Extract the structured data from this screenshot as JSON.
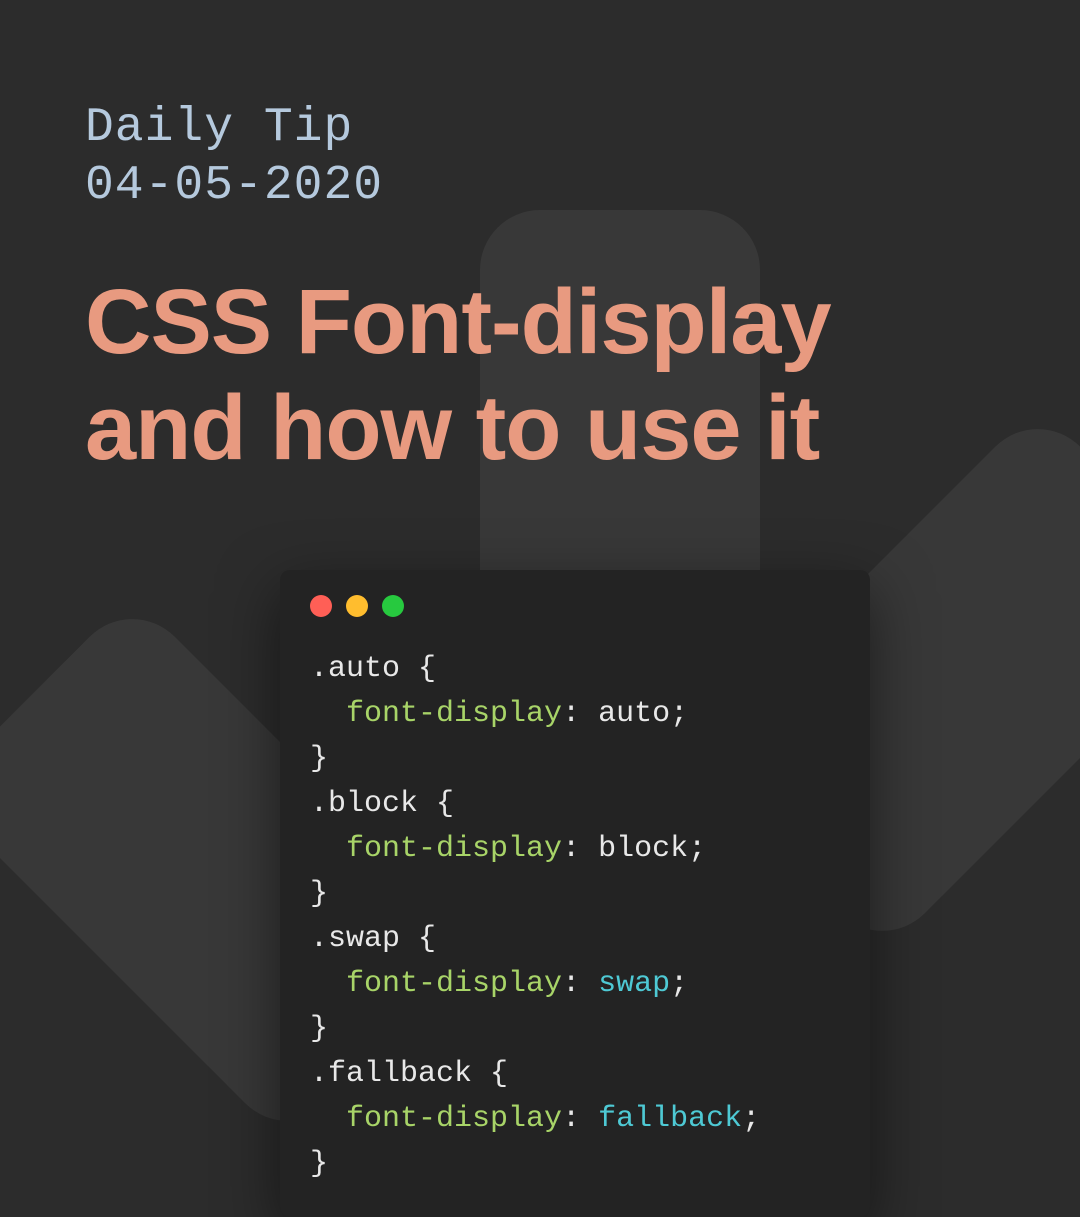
{
  "header": {
    "eyebrow_line1": "Daily Tip",
    "eyebrow_line2": "04-05-2020",
    "title": "CSS Font-display and how to use it"
  },
  "code": {
    "rules": [
      {
        "selector": ".auto",
        "property": "font-display",
        "value": "auto",
        "value_highlighted": false
      },
      {
        "selector": ".block",
        "property": "font-display",
        "value": "block",
        "value_highlighted": false
      },
      {
        "selector": ".swap",
        "property": "font-display",
        "value": "swap",
        "value_highlighted": true
      },
      {
        "selector": ".fallback",
        "property": "font-display",
        "value": "fallback",
        "value_highlighted": true
      }
    ]
  },
  "colors": {
    "background": "#2c2c2c",
    "eyebrow": "#b5c9dd",
    "title": "#e89a80",
    "code_bg": "#232323",
    "code_property": "#a8d468",
    "code_keyword": "#4ec9d4",
    "traffic_red": "#ff5f56",
    "traffic_yellow": "#ffbd2e",
    "traffic_green": "#27c93f"
  }
}
